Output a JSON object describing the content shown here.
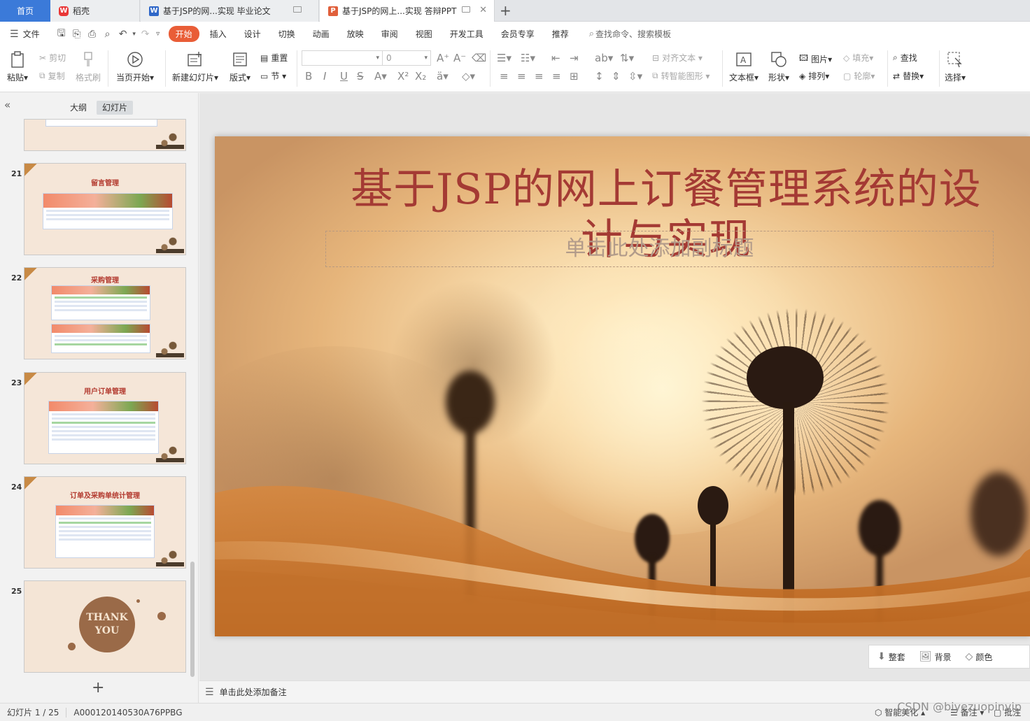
{
  "tabs": {
    "home": "首页",
    "items": [
      {
        "label": "稻壳",
        "icon": "wps-icon"
      },
      {
        "label": "基于JSP的网...实现 毕业论文",
        "icon": "writer-doc-icon"
      },
      {
        "label": "基于JSP的网上...实现 答辩PPT",
        "icon": "presentation-doc-icon"
      }
    ],
    "new_tab": "+"
  },
  "menubar": {
    "file": "文件",
    "items": [
      "开始",
      "插入",
      "设计",
      "切换",
      "动画",
      "放映",
      "审阅",
      "视图",
      "开发工具",
      "会员专享",
      "推荐"
    ],
    "active": "开始",
    "search": "查找命令、搜索模板"
  },
  "ribbon": {
    "paste": "粘贴",
    "cut": "剪切",
    "copy": "复制",
    "format_painter": "格式刷",
    "from_current": "当页开始",
    "new_slide": "新建幻灯片",
    "layout": "版式",
    "reset": "重置",
    "section": "节",
    "font_size": "0",
    "align_text": "对齐文本",
    "smart_art": "转智能图形",
    "textbox": "文本框",
    "shape": "形状",
    "picture": "图片",
    "arrange": "排列",
    "fill": "填充",
    "outline": "轮廓",
    "find": "查找",
    "replace": "替换",
    "select": "选择"
  },
  "left_panel": {
    "tabs": [
      "大纲",
      "幻灯片"
    ],
    "active_tab": "幻灯片",
    "thumbnails": [
      {
        "num": "21",
        "title": "留言管理"
      },
      {
        "num": "22",
        "title": "采购管理"
      },
      {
        "num": "23",
        "title": "用户订单管理"
      },
      {
        "num": "24",
        "title": "订单及采购单统计管理"
      },
      {
        "num": "25",
        "title": "THANK YOU"
      }
    ],
    "add": "+"
  },
  "slide": {
    "title": "基于JSP的网上订餐管理系统的设计与实现",
    "subtitle_placeholder": "单击此处添加副标题"
  },
  "slide_toolbar": {
    "items": [
      "整套",
      "背景",
      "颜色"
    ]
  },
  "notes": {
    "placeholder": "单击此处添加备注"
  },
  "status": {
    "slide_counter": "幻灯片 1 / 25",
    "template_id": "A000120140530A76PPBG",
    "beautify": "智能美化",
    "notes": "备注",
    "comments": "批注"
  },
  "watermark": "CSDN @biyezuopinvip",
  "colors": {
    "accent": "#e95d37",
    "home_tab": "#3b7ad9",
    "title": "#a43a34"
  }
}
